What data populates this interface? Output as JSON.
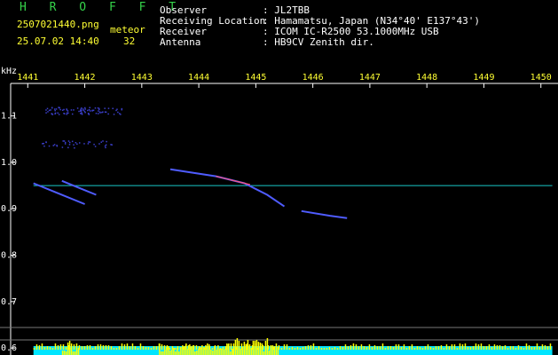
{
  "header": {
    "app_name": "H R O F F T",
    "filename": "2507021440.png",
    "datetime": "25.07.02 14:40",
    "mode_label": "meteor",
    "count": "32",
    "info_rows": [
      {
        "label": "Observer",
        "value": ": JL2TBB"
      },
      {
        "label": "Receiving Location",
        "value": ": Hamamatsu, Japan (N34°40' E137°43')"
      },
      {
        "label": "Receiver",
        "value": ": ICOM IC-R2500 53.1000MHz USB"
      },
      {
        "label": "Antenna",
        "value": ": HB9CV Zenith dir."
      }
    ]
  },
  "colors": {
    "accent_green": "#35d24a",
    "tick_yellow": "#ffff33",
    "trace_cyan": "#19c8c8",
    "meteor_blue": "#4f5cff",
    "level_cyan": "#00e5ff",
    "level_yellow": "#ffff00",
    "axis_white": "#ffffff"
  },
  "chart_data": {
    "type": "line",
    "ylabel": "kHz",
    "x_ticks": [
      "1441",
      "1442",
      "1443",
      "1444",
      "1445",
      "1446",
      "1447",
      "1448",
      "1449",
      "1450"
    ],
    "xlim": [
      1440.7,
      1450.3
    ],
    "y_ticks": [
      "1.1",
      "1.0",
      "0.9",
      "0.8",
      "0.7",
      "0.6"
    ],
    "ylim": [
      0.585,
      1.17
    ],
    "series": [
      {
        "kind": "carrier",
        "x": [
          1441.1,
          1450.2
        ],
        "y": [
          0.95,
          0.95
        ]
      },
      {
        "kind": "meteor",
        "x": [
          1441.1,
          1441.5,
          1442.0
        ],
        "y": [
          0.955,
          0.935,
          0.91
        ]
      },
      {
        "kind": "meteor",
        "x": [
          1441.6,
          1441.9,
          1442.2
        ],
        "y": [
          0.96,
          0.945,
          0.93
        ]
      },
      {
        "kind": "meteor",
        "x": [
          1443.5,
          1444.3,
          1444.8,
          1445.2,
          1445.5
        ],
        "y": [
          0.985,
          0.97,
          0.955,
          0.93,
          0.905
        ]
      },
      {
        "kind": "meteor",
        "x": [
          1445.8,
          1446.3,
          1446.6
        ],
        "y": [
          0.895,
          0.885,
          0.88
        ]
      }
    ],
    "level_strip": {
      "x_start": 1441.1,
      "x_end": 1450.2
    }
  }
}
